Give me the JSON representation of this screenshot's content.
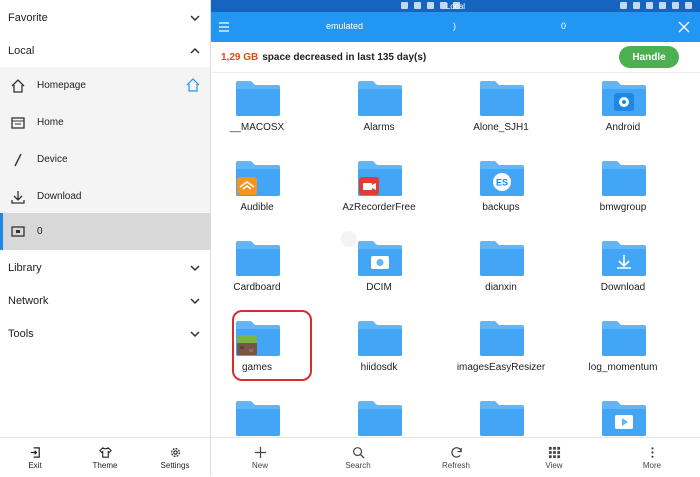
{
  "drawer": {
    "favorite": "Favorite",
    "local": "Local",
    "items": [
      {
        "label": "Homepage",
        "icon": "home-icon"
      },
      {
        "label": "Home",
        "icon": "folder-tabs-icon"
      },
      {
        "label": "Device",
        "icon": "slash-icon"
      },
      {
        "label": "Download",
        "icon": "download-icon"
      },
      {
        "label": "0",
        "icon": "storage-icon"
      }
    ],
    "library": "Library",
    "network": "Network",
    "tools": "Tools",
    "bottom": {
      "exit": "Exit",
      "theme": "Theme",
      "settings": "Settings"
    }
  },
  "statusbar": {
    "title": "Local"
  },
  "topbar": {
    "path": "emulated",
    "paren": ")",
    "count": "0"
  },
  "banner": {
    "amount": "1,29 GB",
    "message": "space decreased in last 135 day(s)",
    "button": "Handle"
  },
  "folders": [
    {
      "name": "__MACOSX"
    },
    {
      "name": "Alarms"
    },
    {
      "name": "Alone_SJH1"
    },
    {
      "name": "Android",
      "badge": "gear-badge-icon"
    },
    {
      "name": "Audible",
      "badge": "audible-app-icon"
    },
    {
      "name": "AzRecorderFree",
      "badge": "recorder-app-icon"
    },
    {
      "name": "backups",
      "badge": "es-badge-icon"
    },
    {
      "name": "bmwgroup"
    },
    {
      "name": "Cardboard"
    },
    {
      "name": "DCIM",
      "badge": "camera-badge-icon"
    },
    {
      "name": "dianxin"
    },
    {
      "name": "Download",
      "badge": "download-badge-icon"
    },
    {
      "name": "games",
      "badge": "minecraft-app-icon"
    },
    {
      "name": "hiidosdk"
    },
    {
      "name": "imagesEasyResizer"
    },
    {
      "name": "log_momentum"
    },
    {
      "name": ""
    },
    {
      "name": ""
    },
    {
      "name": ""
    },
    {
      "name": "",
      "badge": "video-badge-icon"
    }
  ],
  "bottombar": {
    "new": "New",
    "search": "Search",
    "refresh": "Refresh",
    "view": "View",
    "more": "More"
  },
  "colors": {
    "accent": "#2196f3",
    "status": "#1565c0",
    "folder": "#64b5f6",
    "handle": "#4caf50",
    "amount": "#e64a19",
    "highlight": "#d32f2f"
  }
}
